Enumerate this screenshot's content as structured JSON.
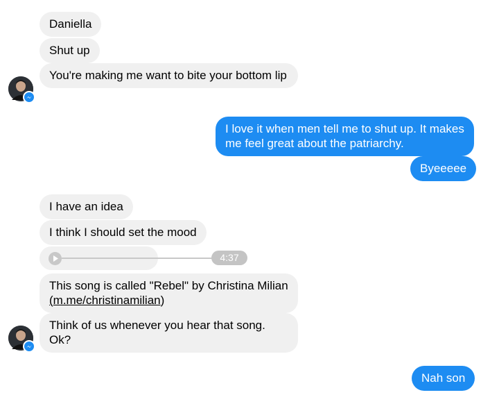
{
  "messages": {
    "m1": "Daniella",
    "m2": "Shut up",
    "m3": "You're making me want to bite your bottom lip",
    "m4": "I love it when men tell me to shut up. It makes me feel great about the patriarchy.",
    "m5": "Byeeeee",
    "m6": "I have an idea",
    "m7": "I think I should set the mood",
    "m9_text": "This song is called \"Rebel\" by Christina Milian",
    "m9_link_open": "(",
    "m9_link": "m.me/christinamilian",
    "m9_link_close": ")",
    "m10": "Think of us whenever you hear that song. Ok?",
    "m11": "Nah son"
  },
  "audio": {
    "duration": "4:37",
    "progress_fraction": 0.57
  },
  "icons": {
    "play": "play-icon",
    "avatar": "contact-avatar",
    "badge": "messenger-badge-icon"
  },
  "colors": {
    "incoming_bubble": "#f0f0f0",
    "outgoing_bubble": "#1d8cf2",
    "audio_track": "#c8c8c8"
  }
}
